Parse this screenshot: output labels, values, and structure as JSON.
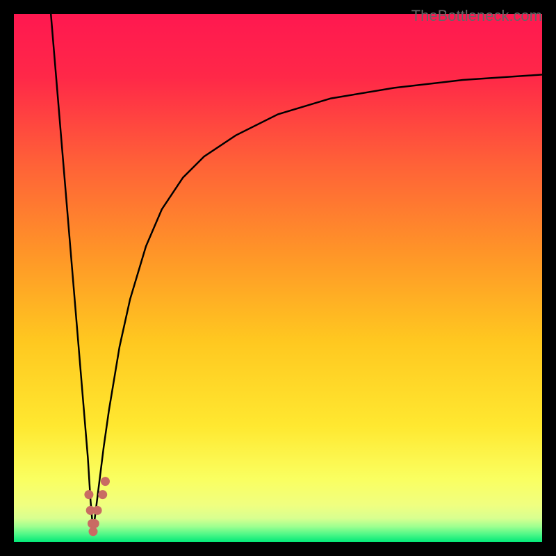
{
  "watermark": "TheBottleneck.com",
  "chart_data": {
    "type": "line",
    "title": "",
    "xlabel": "",
    "ylabel": "",
    "xlim": [
      0,
      100
    ],
    "ylim": [
      0,
      100
    ],
    "gradient_colors": {
      "top": "#ff1744",
      "mid_high": "#ff6030",
      "mid": "#ffa020",
      "mid_low": "#ffe030",
      "low": "#f8ff70",
      "bottom": "#00e676"
    },
    "series": [
      {
        "name": "left-branch",
        "description": "Steep descending line from top-left to valley",
        "x": [
          7,
          8,
          9,
          10,
          11,
          12,
          13,
          14,
          14.5,
          15
        ],
        "y": [
          100,
          88,
          76,
          64,
          52,
          40,
          28,
          16,
          8,
          2
        ]
      },
      {
        "name": "right-branch",
        "description": "Asymptotic rising curve from valley toward top-right",
        "x": [
          15,
          16,
          17,
          18,
          20,
          22,
          25,
          28,
          32,
          36,
          42,
          50,
          60,
          72,
          85,
          100
        ],
        "y": [
          2,
          10,
          18,
          25,
          37,
          46,
          56,
          63,
          69,
          73,
          77,
          81,
          84,
          86,
          87.5,
          88.5
        ]
      }
    ],
    "dots": {
      "description": "Highlighted points near valley minimum",
      "points": [
        {
          "x": 14.2,
          "y": 9
        },
        {
          "x": 14.5,
          "y": 6
        },
        {
          "x": 14.8,
          "y": 3.5
        },
        {
          "x": 15.0,
          "y": 2
        },
        {
          "x": 15.3,
          "y": 3.5
        },
        {
          "x": 15.8,
          "y": 6
        },
        {
          "x": 16.8,
          "y": 9
        },
        {
          "x": 17.3,
          "y": 11.5
        }
      ]
    },
    "valley_x": 15
  }
}
